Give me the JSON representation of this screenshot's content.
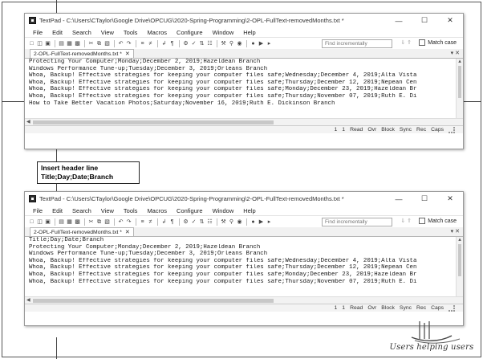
{
  "callout": {
    "line1": "Insert header line",
    "line2": "Title;Day;Date;Branch"
  },
  "brand": {
    "tagline": "Users helping users"
  },
  "window1": {
    "title": "TextPad - C:\\Users\\CTaylor\\Google Drive\\OPCUG\\2020-Spring-Programming\\2-OPL-FullText-removedMonths.txt *",
    "menu": [
      "File",
      "Edit",
      "Search",
      "View",
      "Tools",
      "Macros",
      "Configure",
      "Window",
      "Help"
    ],
    "find_placeholder": "Find incrementally",
    "match_case": "Match case",
    "tab_label": "2-OPL-FullText-removedMonths.txt *",
    "lines": [
      "Protecting Your Computer;Monday;December 2, 2019;Hazeldean Branch",
      "Windows Performance Tune-up;Tuesday;December 3, 2019;Orleans Branch",
      "Whoa, Backup! Effective strategies for keeping your computer files safe;Wednesday;December 4, 2019;Alta Vista",
      "Whoa, Backup! Effective strategies for keeping your computer files safe;Thursday;December 12, 2019;Nepean Cen",
      "Whoa, Backup! Effective strategies for keeping your computer files safe;Monday;December 23, 2019;Hazeldean Br",
      "Whoa, Backup! Effective strategies for keeping your computer files safe;Thursday;November 07, 2019;Ruth E. Di",
      "How to Take Better Vacation Photos;Saturday;November 16, 2019;Ruth E. Dickinson Branch"
    ],
    "status": [
      "1",
      "1",
      "Read",
      "Ovr",
      "Block",
      "Sync",
      "Rec",
      "Caps"
    ]
  },
  "window2": {
    "title": "TextPad - C:\\Users\\CTaylor\\Google Drive\\OPCUG\\2020-Spring-Programming\\2-OPL-FullText-removedMonths.txt *",
    "menu": [
      "File",
      "Edit",
      "Search",
      "View",
      "Tools",
      "Macros",
      "Configure",
      "Window",
      "Help"
    ],
    "find_placeholder": "Find incrementally",
    "match_case": "Match case",
    "tab_label": "2-OPL-FullText-removedMonths.txt *",
    "lines": [
      "Title;Day;Date;Branch",
      "Protecting Your Computer;Monday;December 2, 2019;Hazeldean Branch",
      "Windows Performance Tune-up;Tuesday;December 3, 2019;Orleans Branch",
      "Whoa, Backup! Effective strategies for keeping your computer files safe;Wednesday;December 4, 2019;Alta Vista",
      "Whoa, Backup! Effective strategies for keeping your computer files safe;Thursday;December 12, 2019;Nepean Cen",
      "Whoa, Backup! Effective strategies for keeping your computer files safe;Monday;December 23, 2019;Hazeldean Br",
      "Whoa, Backup! Effective strategies for keeping your computer files safe;Thursday;November 07, 2019;Ruth E. Di"
    ],
    "status": [
      "1",
      "1",
      "Read",
      "Ovr",
      "Block",
      "Sync",
      "Rec",
      "Caps"
    ]
  }
}
